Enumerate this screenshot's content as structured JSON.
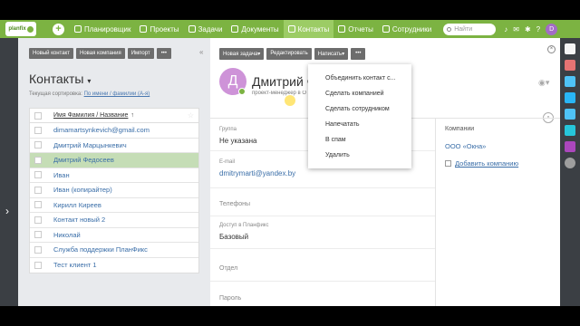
{
  "topbar": {
    "logo": "planfix",
    "nav": [
      {
        "label": "Планировщик"
      },
      {
        "label": "Проекты"
      },
      {
        "label": "Задачи"
      },
      {
        "label": "Документы"
      },
      {
        "label": "Контакты"
      },
      {
        "label": "Отчеты"
      },
      {
        "label": "Сотрудники"
      }
    ],
    "search_placeholder": "Найти",
    "avatar_letter": "D"
  },
  "list": {
    "toolbar": [
      "Новый контакт",
      "Новая компания",
      "Импорт",
      "•••"
    ],
    "title": "Контакты",
    "sort_label": "Текущая сортировка:",
    "sort_value": "По имени / фамилии (А-я)",
    "column_header": "Имя Фамилия / Название",
    "rows": [
      {
        "name": "dimamartsynkevich@gmail.com"
      },
      {
        "name": "Дмитрий Марцынкевич"
      },
      {
        "name": "Дмитрий Федосеев"
      },
      {
        "name": "Иван"
      },
      {
        "name": "Иван (копирайтер)"
      },
      {
        "name": "Кирилл Киреев"
      },
      {
        "name": "Контакт новый 2"
      },
      {
        "name": "Николай"
      },
      {
        "name": "Служба поддержки ПланФикс"
      },
      {
        "name": "Тест клиент 1"
      }
    ]
  },
  "detail": {
    "toolbar": [
      "Новая задача▾",
      "Редактировать",
      "Написать▾",
      "•••"
    ],
    "avatar_letter": "Д",
    "name": "Дмитрий Ф",
    "subtitle": "проект-менеджер в О",
    "fields": {
      "group_label": "Группа",
      "group_value": "Не указана",
      "email_label": "E-mail",
      "email_value": "dmitrymarti@yandex.by",
      "phones_label": "Телефоны",
      "access_label": "Доступ в Планфикс",
      "access_value": "Базовый",
      "dept_label": "Отдел",
      "password_label": "Пароль"
    },
    "companies": {
      "title": "Компании",
      "company": "ООО «Окна»",
      "add": "Добавить компанию"
    }
  },
  "menu": {
    "items": [
      "Объединить контакт с...",
      "Сделать компанией",
      "Сделать сотрудником",
      "Напечатать",
      "В спам",
      "Удалить"
    ]
  },
  "colors": {
    "brand_green": "#7cb342",
    "avatar_purple": "#ce93d8",
    "link_blue": "#3a6ea8",
    "selected_row": "#c5ddb6"
  }
}
